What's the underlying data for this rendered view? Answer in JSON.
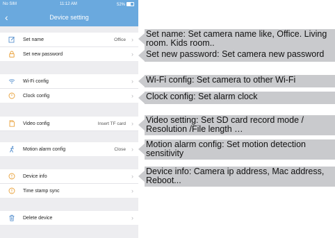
{
  "status_bar": {
    "carrier": "No SIM",
    "time": "11:12 AM",
    "battery": "52%"
  },
  "nav": {
    "back_glyph": "‹",
    "title": "Device setting"
  },
  "rows": {
    "set_name": {
      "label": "Set name",
      "value": "Office",
      "icon": "edit-icon"
    },
    "set_password": {
      "label": "Set new password",
      "icon": "lock-icon"
    },
    "wifi": {
      "label": "Wi-Fi config",
      "icon": "wifi-icon"
    },
    "clock": {
      "label": "Clock config",
      "icon": "clock-icon"
    },
    "video": {
      "label": "Video config",
      "value": "Insert TF card",
      "icon": "sd-card-icon"
    },
    "motion": {
      "label": "Motion alarm config",
      "value": "Close",
      "icon": "motion-person-icon"
    },
    "device_info": {
      "label": "Device info",
      "icon": "info-icon"
    },
    "timestamp": {
      "label": "Time stamp sync",
      "icon": "time-sync-icon"
    },
    "delete": {
      "label": "Delete device",
      "icon": "trash-icon"
    }
  },
  "callouts": {
    "set_name": [
      "Set name:  Set camera name like, Office. Living",
      "room. Kids room.."
    ],
    "set_password": [
      "Set new password: Set camera new password"
    ],
    "wifi": [
      "Wi-Fi config:  Set camera to other Wi-Fi"
    ],
    "clock": [
      "Clock config: Set alarm clock"
    ],
    "video": [
      "Video setting:  Set SD card record mode /",
      "Resolution /File length …"
    ],
    "motion": [
      "Motion alarm config:  Set motion detection",
      "sensitivity"
    ],
    "device_info": [
      "Device info: Camera ip address, Mac address,",
      "Reboot..."
    ]
  },
  "colors": {
    "header_blue": "#6aa9de",
    "icon_blue": "#5b93cf",
    "icon_orange": "#e9a23c",
    "callout_gray": "#c9cacd"
  }
}
